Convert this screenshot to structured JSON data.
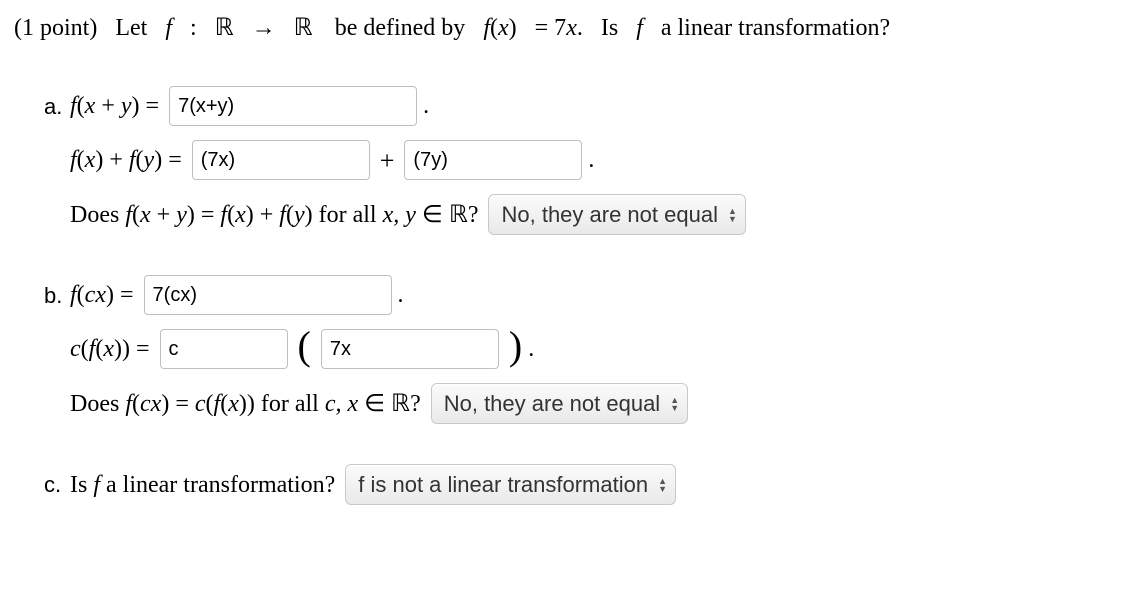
{
  "prompt": {
    "points": "(1 point)",
    "let": "Let",
    "colon": ":",
    "R1": "ℝ",
    "arrow": "→",
    "R2": "ℝ",
    "defined": "be defined by",
    "fx_eq": "= 7",
    "dot": ".",
    "xvar": "x",
    "q": "Is",
    "tail": "a linear transformation?"
  },
  "a": {
    "letter": "a.",
    "lhs1_pre": "f",
    "lhs1_open": "(",
    "lhs1_x": "x",
    "lhs1_plus": "+",
    "lhs1_y": "y",
    "lhs1_close": ")",
    "eq": "=",
    "input1": "7(x+y)",
    "period": ".",
    "lhs2_fx": "f",
    "lhs2_xopen": "(",
    "lhs2_x": "x",
    "lhs2_xclose": ")",
    "lhs2_plus": "+",
    "lhs2_fy": "f",
    "lhs2_yopen": "(",
    "lhs2_y": "y",
    "lhs2_yclose": ")",
    "input2": "(7x)",
    "midplus": "+",
    "input3": "(7y)",
    "q_prefix": "Does",
    "q_body1": "f",
    "q_body1a": "(",
    "q_body1x": "x",
    "q_body1p": "+",
    "q_body1y": "y",
    "q_body1b": ")",
    "q_eq": "=",
    "q_body2": "f",
    "q_body2a": "(",
    "q_body2x": "x",
    "q_body2b": ")",
    "q_body2p": "+",
    "q_body3": "f",
    "q_body3a": "(",
    "q_body3y": "y",
    "q_body3b": ")",
    "q_for": "for all",
    "q_xy": "x, y",
    "q_in": "∈",
    "q_R": "ℝ",
    "q_mark": "?",
    "select": "No, they are not equal"
  },
  "b": {
    "letter": "b.",
    "lhs1": "f",
    "lhs1a": "(",
    "lhs1c": "c",
    "lhs1x": "x",
    "lhs1b": ")",
    "eq": "=",
    "input1": "7(cx)",
    "period": ".",
    "lhs2c": "c",
    "lhs2a": "(",
    "lhs2f": "f",
    "lhs2fa": "(",
    "lhs2x": "x",
    "lhs2fb": ")",
    "lhs2b": ")",
    "input2": "c",
    "big_open": "(",
    "input3": "7x",
    "big_close": ")",
    "period2": ".",
    "q_prefix": "Does",
    "q_f": "f",
    "q_fa": "(",
    "q_fc": "c",
    "q_fx": "x",
    "q_fb": ")",
    "q_eq": "=",
    "q_c": "c",
    "q_ca": "(",
    "q_cf": "f",
    "q_cfa": "(",
    "q_cfx": "x",
    "q_cfb": ")",
    "q_cb": ")",
    "q_for": "for all",
    "q_cx": "c, x",
    "q_in": "∈",
    "q_R": "ℝ",
    "q_mark": "?",
    "select": "No, they are not equal"
  },
  "c": {
    "letter": "c.",
    "q_is": "Is",
    "q_f": "f",
    "q_tail": "a linear transformation?",
    "select": "f is not a linear transformation"
  }
}
